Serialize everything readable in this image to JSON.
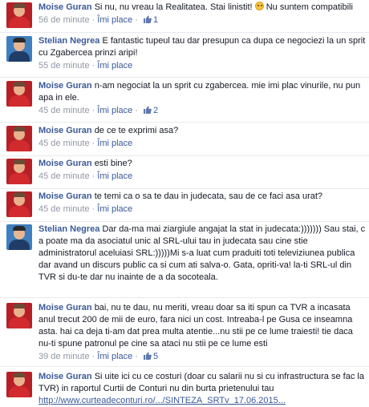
{
  "like_label": "Îmi place",
  "comments": [
    {
      "author": "Moise Guran",
      "text": "Si nu, nu vreau la Realitatea. Stai linistit!",
      "text_after": "Nu suntem compatibili",
      "time": "56 de minute",
      "likes": "1"
    },
    {
      "author": "Stelian Negrea",
      "text": "E fantastic tupeul tau dar presupun ca dupa ce negociezi la un sprit cu Zgabercea prinzi aripi!",
      "time": "55 de minute",
      "likes": ""
    },
    {
      "author": "Moise Guran",
      "text": "n-am negociat la un sprit cu zgabercea. mie imi plac vinurile, nu pun apa in ele.",
      "time": "45 de minute",
      "likes": "2"
    },
    {
      "author": "Moise Guran",
      "text": "de ce te exprimi asa?",
      "time": "45 de minute",
      "likes": ""
    },
    {
      "author": "Moise Guran",
      "text": "esti bine?",
      "time": "45 de minute",
      "likes": ""
    },
    {
      "author": "Moise Guran",
      "text": "te temi ca o sa te dau in judecata, sau de ce faci asa urat?",
      "time": "45 de minute",
      "likes": ""
    },
    {
      "author": "Stelian Negrea",
      "text": "Dar da-ma mai ziargiule angajat la stat in judecata:))))))) Sau stai, c a poate ma da asociatul unic al SRL-ului tau in judecata sau cine stie administratorul aceluiasi SRL:)))))Mi s-a luat cum praduiti toti televiziunea publica dar avand un discurs public ca si cum ati salva-o. Gata, opriti-va! la-ti SRL-ul din TVR si du-te dar nu inainte de a da socoteala.",
      "time": "",
      "likes": ""
    },
    {
      "author": "Moise Guran",
      "text": "bai, nu te dau, nu meriti, vreau doar sa iti spun ca TVR a incasata anul trecut 200 de mii de euro, fara nici un cost. Intreaba-l pe Gusa ce inseamna asta. hai ca deja ti-am dat prea multa atentie...nu stii pe ce lume traiesti! tie daca nu-ti spune patronul pe cine sa ataci nu stii pe ce lume esti",
      "time": "39 de minute",
      "likes": "5"
    },
    {
      "author": "Moise Guran",
      "text": "Si uite ici cu ce costuri (doar cu salarii nu si cu infrastructura se fac la TVR) in raportul Curtii de Conturi nu din burta prietenului tau",
      "link": "http://www.curteadeconturi.ro/.../SINTEZA_SRTv_17.06.2015...",
      "time": "",
      "likes": ""
    }
  ]
}
